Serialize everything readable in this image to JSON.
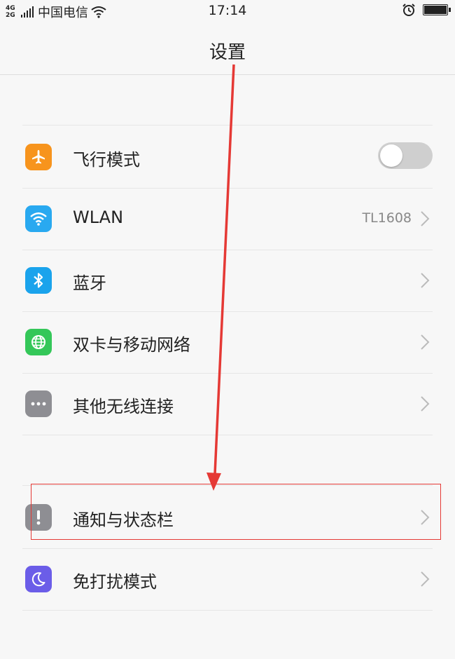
{
  "status_bar": {
    "signal_label": "4G\n2G",
    "carrier": "中国电信",
    "time": "17:14",
    "battery_level": 0.95
  },
  "header": {
    "title": "设置"
  },
  "settings": [
    {
      "label": "飞行模式",
      "icon": "airplane-icon",
      "color": "#f7941d",
      "control": "toggle",
      "toggle_on": false
    },
    {
      "label": "WLAN",
      "icon": "wifi-icon",
      "color": "#29a9f0",
      "control": "chevron",
      "value": "TL1608"
    },
    {
      "label": "蓝牙",
      "icon": "bluetooth-icon",
      "color": "#1aa3ec",
      "control": "chevron"
    },
    {
      "label": "双卡与移动网络",
      "icon": "globe-icon",
      "color": "#34c759",
      "control": "chevron"
    },
    {
      "label": "其他无线连接",
      "icon": "more-icon",
      "color": "#8e8e93",
      "control": "chevron"
    },
    {
      "label": "通知与状态栏",
      "icon": "exclamation-icon",
      "color": "#8e8e93",
      "control": "chevron"
    },
    {
      "label": "免打扰模式",
      "icon": "moon-icon",
      "color": "#6b5de8",
      "control": "chevron"
    }
  ],
  "annotation": {
    "color": "#e53935"
  }
}
